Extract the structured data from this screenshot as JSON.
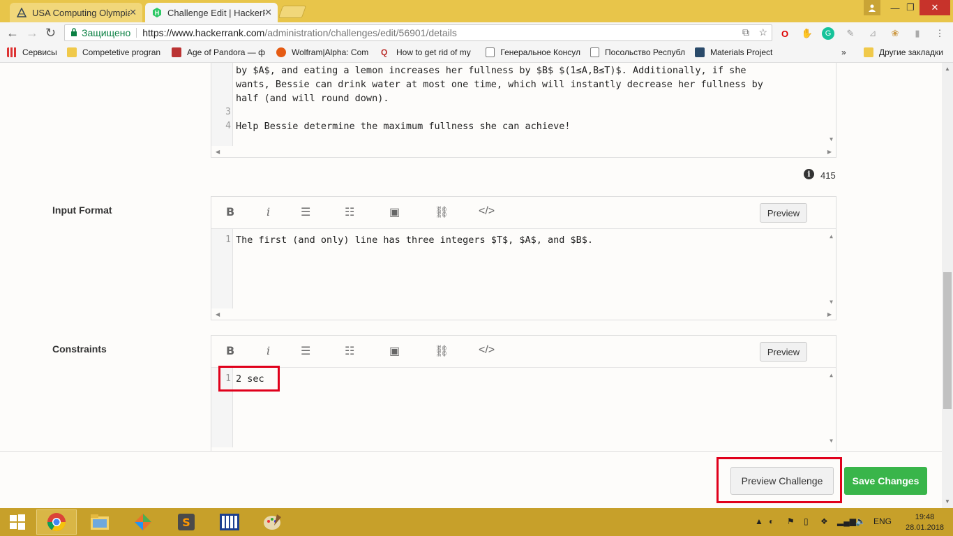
{
  "browser": {
    "tabs": [
      {
        "title": "USA Computing Olympia",
        "active": false
      },
      {
        "title": "Challenge Edit | HackerRa",
        "active": true
      }
    ],
    "secure_label": "Защищено",
    "url_host": "https://www.hackerrank.com",
    "url_path": "/administration/challenges/edit/56901/details"
  },
  "bookmarks": {
    "apps": "Сервисы",
    "items": [
      "Competetive progran",
      "Age of Pandora — ф",
      "Wolfram|Alpha: Com",
      "How to get rid of my",
      "Генеральное Консул",
      "Посольство Республ",
      "Materials Project"
    ],
    "more": "»",
    "other": "Другие закладки"
  },
  "statement_editor": {
    "lines": [
      {
        "num": "",
        "text": "by $A$, and eating a lemon increases her fullness by $B$ $(1≤A,B≤T)$. Additionally, if she"
      },
      {
        "num": "",
        "text": "wants, Bessie can drink water at most one time, which will instantly decrease her fullness by"
      },
      {
        "num": "",
        "text": "half (and will round down)."
      },
      {
        "num": "3",
        "text": ""
      },
      {
        "num": "4",
        "text": "Help Bessie determine the maximum fullness she can achieve!"
      }
    ],
    "char_count": "415"
  },
  "input_format": {
    "label": "Input Format",
    "preview_label": "Preview",
    "lines": [
      {
        "num": "1",
        "text": "The first (and only) line has three integers $T$, $A$, and $B$."
      }
    ]
  },
  "constraints": {
    "label": "Constraints",
    "preview_label": "Preview",
    "lines": [
      {
        "num": "1",
        "text": "2 sec"
      }
    ]
  },
  "footer": {
    "preview_challenge": "Preview Challenge",
    "save_changes": "Save Changes"
  },
  "taskbar": {
    "lang": "ENG",
    "time": "19:48",
    "date": "28.01.2018"
  },
  "colors": {
    "save_green": "#39b54a",
    "highlight_red": "#e0001b",
    "taskbar": "#c7a02a",
    "titlebar": "#e8c54a"
  }
}
